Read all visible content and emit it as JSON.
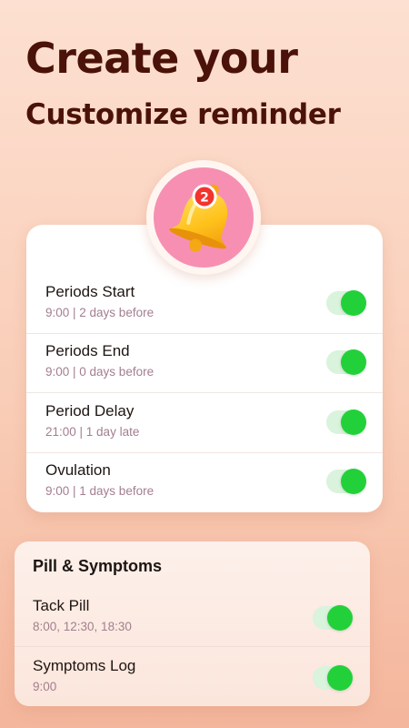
{
  "header": {
    "title": "Create your",
    "subtitle": "Customize reminder"
  },
  "bell": {
    "icon": "bell-icon",
    "badge_count": "2"
  },
  "reminders": [
    {
      "title": "Periods Start",
      "detail": "9:00 | 2 days before",
      "enabled": true
    },
    {
      "title": "Periods End",
      "detail": "9:00 | 0 days before",
      "enabled": true
    },
    {
      "title": "Period Delay",
      "detail": "21:00 | 1 day late",
      "enabled": true
    },
    {
      "title": "Ovulation",
      "detail": "9:00 | 1 days before",
      "enabled": true
    }
  ],
  "pill_section": {
    "title": "Pill & Symptoms",
    "items": [
      {
        "title": "Tack Pill",
        "detail": "8:00, 12:30, 18:30",
        "enabled": true
      },
      {
        "title": "Symptoms Log",
        "detail": "9:00",
        "enabled": true
      }
    ]
  },
  "colors": {
    "title": "#4a1208",
    "toggle_on": "#22d13a",
    "bell_circle": "#f78fb3",
    "detail_text": "#a37e8f"
  }
}
